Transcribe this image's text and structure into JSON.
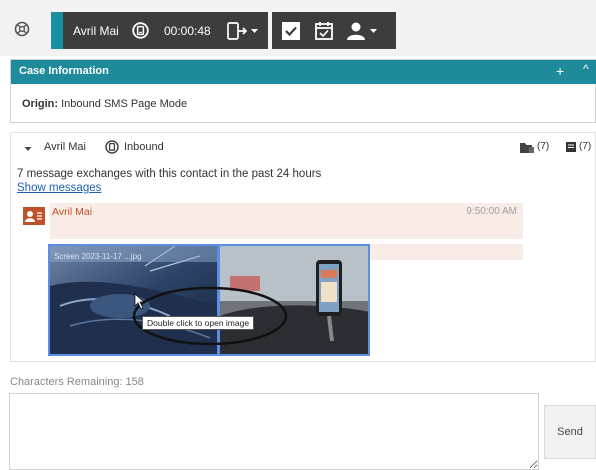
{
  "call_controls": {
    "contact_name": "Avril Mai",
    "timer": "00:00:48",
    "icons": [
      "globe-icon",
      "hold-icon",
      "transfer-icon",
      "checkbox-icon",
      "calendar-icon",
      "add-contact-icon"
    ]
  },
  "case_information": {
    "title": "Case Information",
    "plus_label": "+",
    "collapse_label": "^",
    "origin_label": "Origin:",
    "origin_value": "Inbound SMS Page Mode"
  },
  "conversation": {
    "contact_name": "Avril Mai",
    "direction": "Inbound",
    "count_a": "(7)",
    "count_b": "(7)",
    "history_text": "7 message exchanges with this contact in the past 24 hours",
    "show_messages_link": "Show messages",
    "message": {
      "sender": "Avril Mai",
      "time": "9:50:00 AM"
    },
    "attachment": {
      "file_name": "Screen 2023-11-17 ...jpg",
      "tooltip": "Double click to open image"
    }
  },
  "composer": {
    "chars_remaining_label": "Characters Remaining: 158",
    "text_value": "",
    "send_label": "Send"
  },
  "colors": {
    "toolbar_dark": "#3d3d3d",
    "accent_teal": "#1e8a9a",
    "sender_orange": "#c0522b",
    "bubble_bg": "#f9ece7",
    "link_blue": "#1f5fb8",
    "selection_blue": "#5b8fe6"
  }
}
